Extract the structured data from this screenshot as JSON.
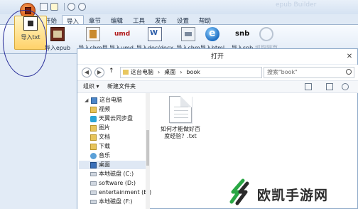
{
  "app": {
    "watermark": "epub Builder",
    "tabs": [
      {
        "label": "开始"
      },
      {
        "label": "导入"
      },
      {
        "label": "章节"
      },
      {
        "label": "编辑"
      },
      {
        "label": "工具"
      },
      {
        "label": "发布"
      },
      {
        "label": "设置"
      },
      {
        "label": "帮助"
      }
    ],
    "active_tab": "导入",
    "ribbon": [
      {
        "label": "导入txt",
        "icon": "txt-file-icon"
      },
      {
        "label": "导入epub",
        "icon": "epub-book-icon"
      },
      {
        "label": "导入chm目录",
        "icon": "chm-icon"
      },
      {
        "label": "导入umd",
        "icon": "umd-icon"
      },
      {
        "label": "导入doc/docx",
        "icon": "word-doc-icon"
      },
      {
        "label": "导入chm",
        "icon": "chm-file-icon"
      },
      {
        "label": "导入html",
        "icon": "ie-globe-icon"
      },
      {
        "label": "导入snb",
        "icon": "snb-icon"
      },
      {
        "label": "抓取网页",
        "icon": "web-grab-icon"
      }
    ]
  },
  "dialog": {
    "title": "打开",
    "close": "✕",
    "path": [
      "这台电脑",
      "桌面",
      "book"
    ],
    "search_placeholder": "搜索\"book\"",
    "toolbar": {
      "organize": "组织 ▾",
      "new_folder": "新建文件夹"
    },
    "nav_items": [
      {
        "label": "这台电脑",
        "icon": "pc",
        "level": 0,
        "expand": "◢"
      },
      {
        "label": "视频",
        "icon": "folder",
        "level": 1
      },
      {
        "label": "天翼云同步盘",
        "icon": "cloud",
        "level": 1
      },
      {
        "label": "图片",
        "icon": "folder",
        "level": 1
      },
      {
        "label": "文档",
        "icon": "folder",
        "level": 1
      },
      {
        "label": "下载",
        "icon": "folder",
        "level": 1
      },
      {
        "label": "音乐",
        "icon": "music",
        "level": 1
      },
      {
        "label": "桌面",
        "icon": "desk",
        "level": 1,
        "selected": true
      },
      {
        "label": "本地磁盘 (C:)",
        "icon": "drive",
        "level": 1
      },
      {
        "label": "software (D:)",
        "icon": "drive",
        "level": 1
      },
      {
        "label": "entertainment (E:)",
        "icon": "drive",
        "level": 1
      },
      {
        "label": "本地磁盘 (F:)",
        "icon": "drive",
        "level": 1
      }
    ],
    "files": [
      {
        "name": "如何才能做好百度经验？.txt"
      }
    ]
  },
  "brand": {
    "text": "欧凯手游网"
  },
  "colors": {
    "annotation": "#2a2f9a",
    "accent": "#ffd26a"
  }
}
